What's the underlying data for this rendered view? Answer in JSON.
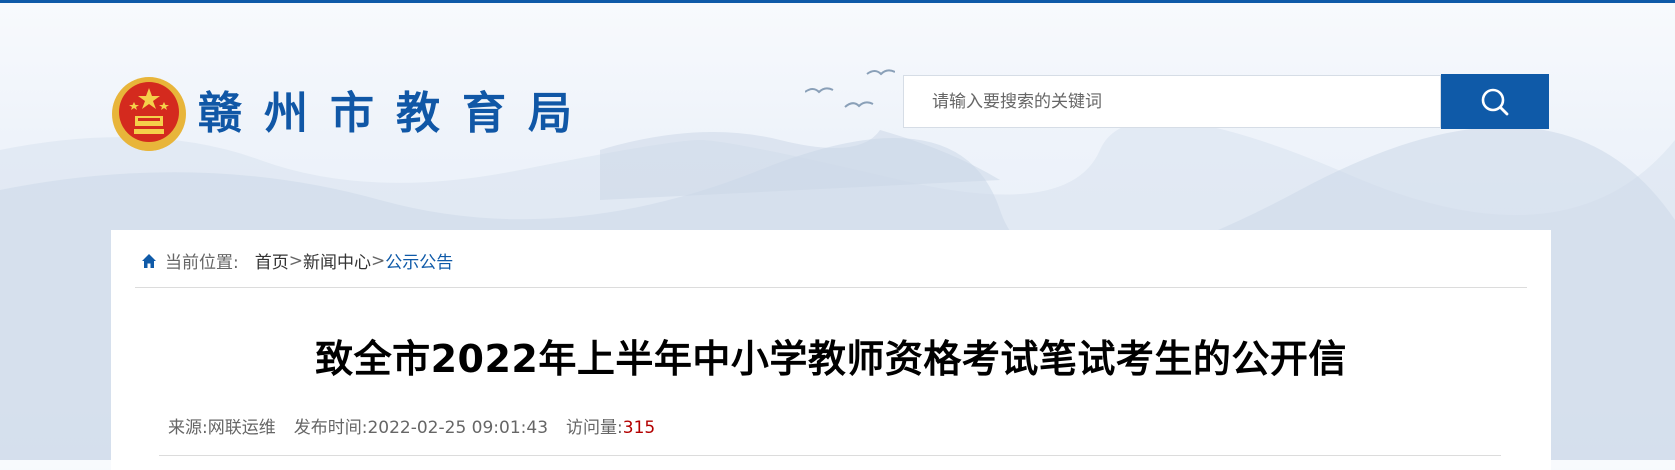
{
  "header": {
    "site_name": "赣州市教育局",
    "emblem_icon": "national-emblem-icon",
    "brand_color": "#0f5aa8"
  },
  "search": {
    "placeholder": "请输入要搜索的关键词",
    "button_icon": "search-icon"
  },
  "breadcrumb": {
    "icon": "home-icon",
    "label": "当前位置:",
    "items": [
      "首页",
      "新闻中心",
      "公示公告"
    ],
    "separator": ">"
  },
  "article": {
    "title": "致全市2022年上半年中小学教师资格考试笔试考生的公开信",
    "source_label": "来源:",
    "source_value": "网联运维",
    "published_label": "发布时间:",
    "published_value": "2022-02-25 09:01:43",
    "views_label": "访问量:",
    "views_value": "315",
    "views_color": "#b30000"
  }
}
